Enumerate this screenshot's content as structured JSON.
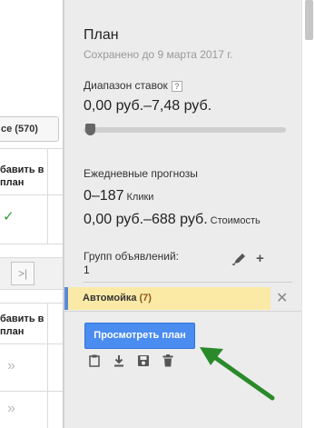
{
  "left_panel": {
    "filter_pill": "ce (570)",
    "column_header_1": [
      "бавить в",
      "план"
    ],
    "column_header_2": [
      "бавить в",
      "план"
    ],
    "pager_last": ">|",
    "row_icon": "»"
  },
  "plan": {
    "title": "План",
    "saved_text": "Сохранено до 9 марта 2017 г.",
    "bid_range_label": "Диапазон ставок",
    "help_glyph": "?",
    "bid_range_value": "0,00 руб.–7,48 руб.",
    "forecast_label": "Ежедневные прогнозы",
    "clicks_value": "0–187",
    "clicks_unit": "Клики",
    "cost_value": "0,00 руб.–688 руб.",
    "cost_unit": "Стоимость",
    "ad_groups_label": "Групп объявлений:",
    "ad_groups_count": "1",
    "ad_group_name": "Автомойка",
    "ad_group_count": "(7)",
    "view_plan_button": "Просмотреть план"
  },
  "colors": {
    "accent": "#4a8cf0",
    "adgroup_bg": "#fbeaa6",
    "arrow": "#2a8a2a",
    "check": "#2e9d3a"
  },
  "icons": [
    "help-icon",
    "edit-icon",
    "add-icon",
    "close-icon",
    "clipboard-icon",
    "download-icon",
    "save-icon",
    "trash-icon",
    "check-icon",
    "arrow-annotation"
  ]
}
